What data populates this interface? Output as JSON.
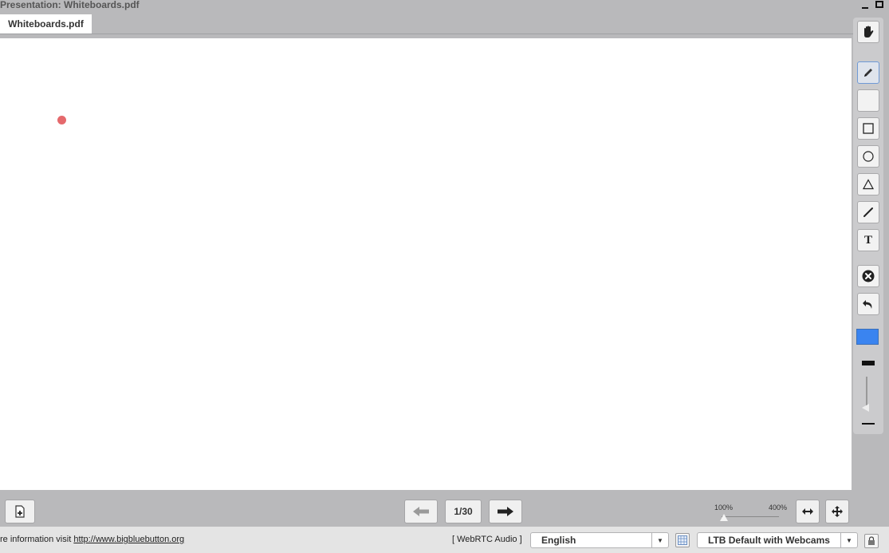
{
  "window": {
    "title": "Presentation: Whiteboards.pdf"
  },
  "tabs": [
    {
      "label": "Whiteboards.pdf"
    }
  ],
  "whiteboard": {
    "pen_color": "#3a84f0",
    "cursor_color": "#e5696c"
  },
  "toolbar": {
    "tools": [
      {
        "name": "pan-hand"
      },
      {
        "name": "pencil",
        "active": true
      },
      {
        "name": "blank"
      },
      {
        "name": "rectangle"
      },
      {
        "name": "ellipse"
      },
      {
        "name": "triangle"
      },
      {
        "name": "line"
      },
      {
        "name": "text",
        "glyph": "T"
      },
      {
        "name": "clear"
      },
      {
        "name": "undo"
      }
    ]
  },
  "presentation_controls": {
    "page": "1/30",
    "zoom_min": "100%",
    "zoom_max": "400%"
  },
  "status": {
    "info_prefix": "re information visit",
    "info_link": "http://www.bigbluebutton.org",
    "audio": "[ WebRTC Audio ]",
    "language": "English",
    "layout": "LTB Default with Webcams"
  }
}
